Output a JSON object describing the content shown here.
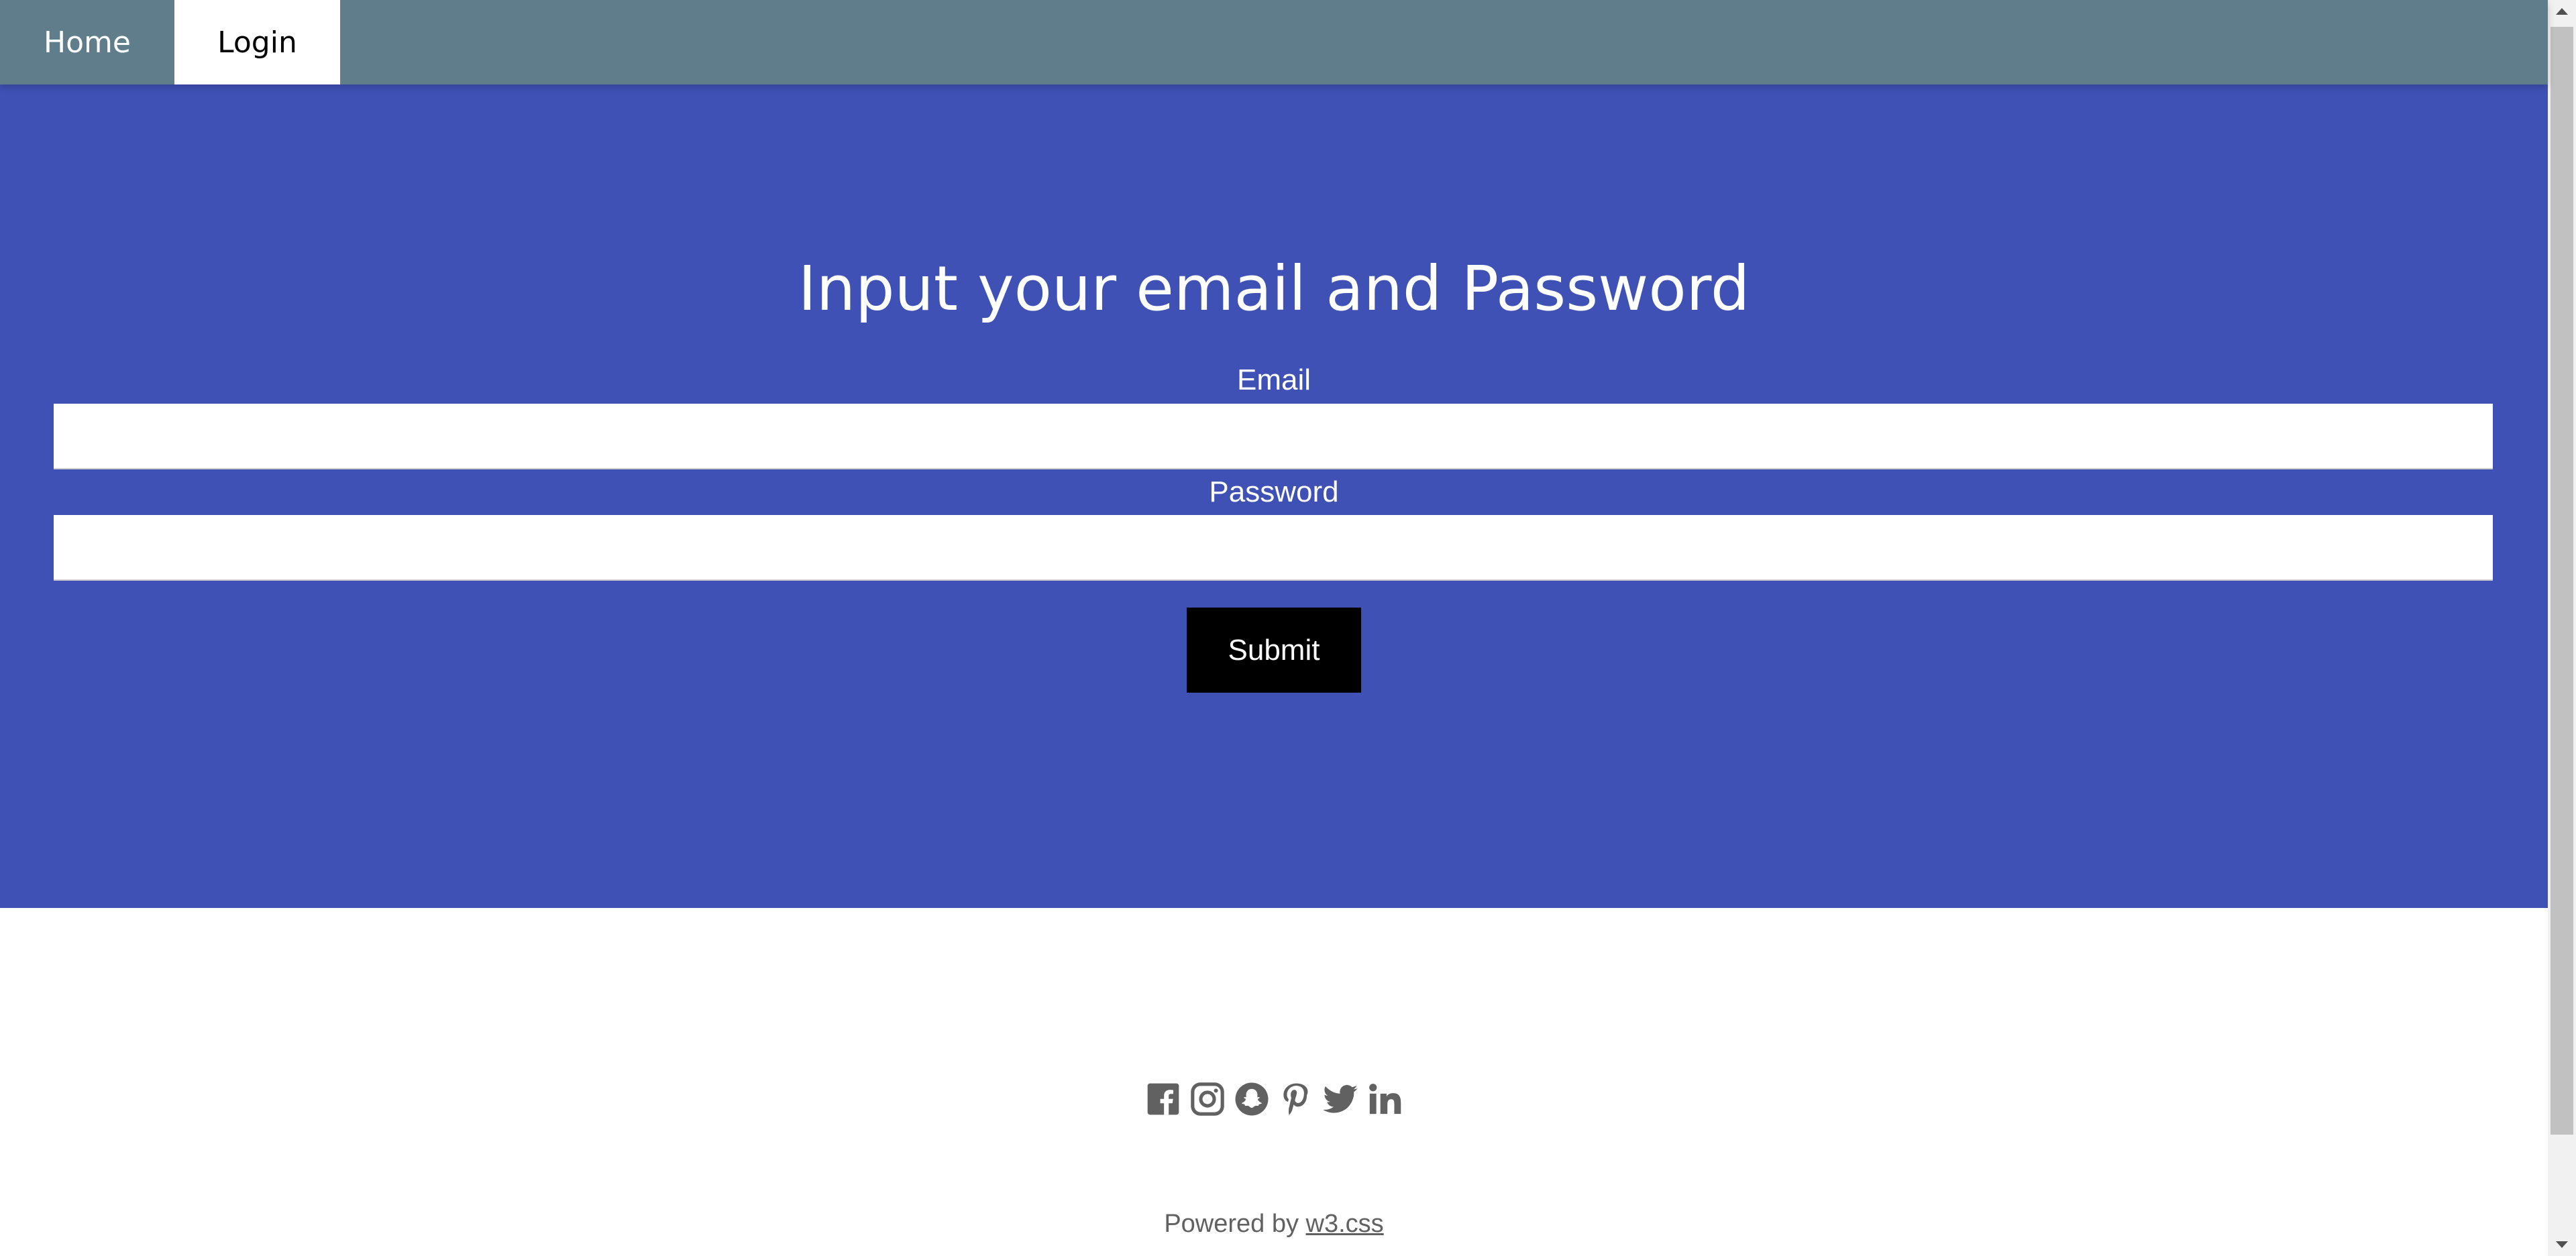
{
  "nav": {
    "items": [
      {
        "label": "Home",
        "active": false
      },
      {
        "label": "Login",
        "active": true
      }
    ]
  },
  "form": {
    "title": "Input your email and Password",
    "email_label": "Email",
    "email_value": "",
    "password_label": "Password",
    "password_value": "",
    "submit_label": "Submit"
  },
  "footer": {
    "social_icons": [
      "facebook-icon",
      "instagram-icon",
      "snapchat-icon",
      "pinterest-icon",
      "twitter-icon",
      "linkedin-icon"
    ],
    "powered_prefix": "Powered by",
    "powered_link": "w3.css"
  },
  "colors": {
    "nav_bg": "#607d8b",
    "hero_bg": "#3f51b5",
    "button_bg": "#000000",
    "icon_color": "#616161"
  }
}
